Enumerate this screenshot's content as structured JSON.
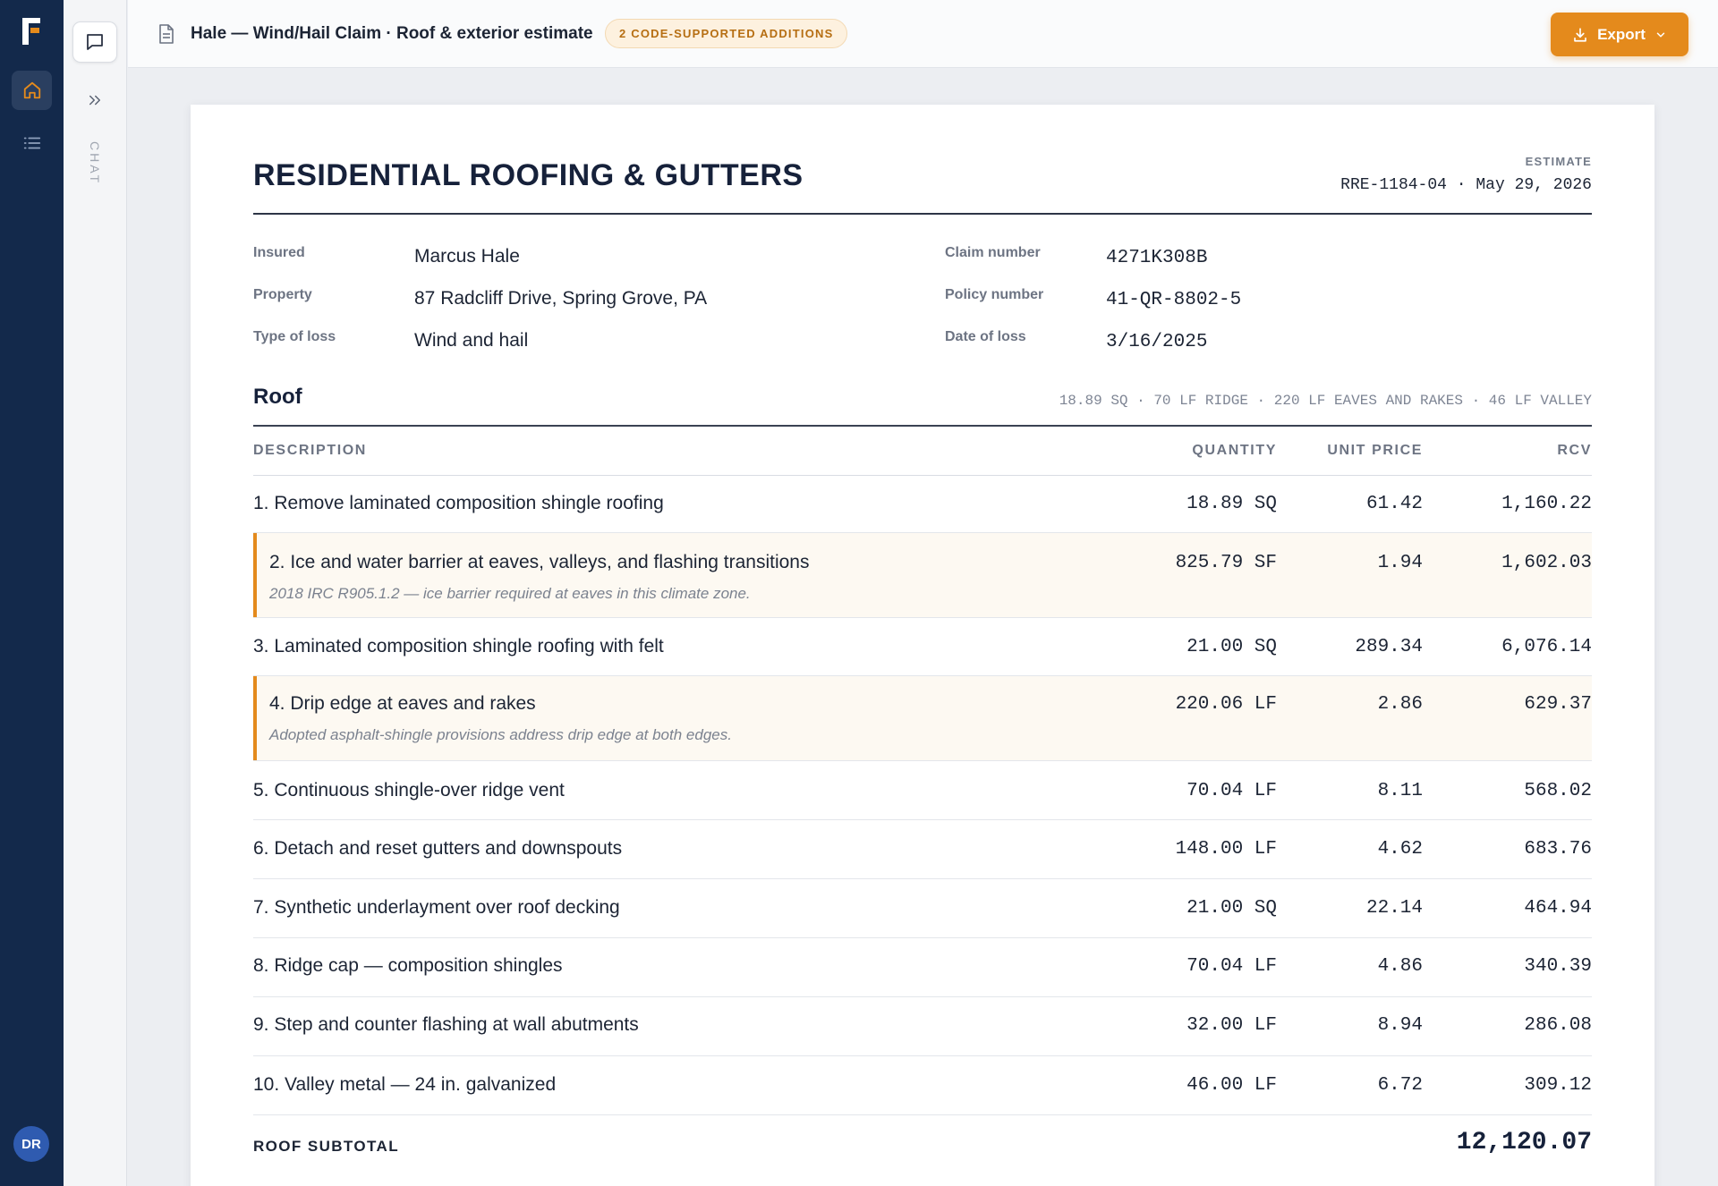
{
  "colors": {
    "rail": "#13294b",
    "accent": "#e48a1c",
    "badge_bg": "#fdf1df",
    "flag_bg": "#fdf9f2"
  },
  "rail": {
    "avatar_initials": "DR",
    "icons": [
      "home-icon",
      "list-icon"
    ]
  },
  "panel": {
    "chat_label": "CHAT",
    "icons": [
      "chat-bubble-icon",
      "double-chevron-right-icon"
    ]
  },
  "header": {
    "title": "Hale — Wind/Hail Claim · Roof & exterior estimate",
    "badge": "2 CODE-SUPPORTED ADDITIONS",
    "export_label": "Export"
  },
  "doc": {
    "title": "RESIDENTIAL ROOFING & GUTTERS",
    "estimate_label": "ESTIMATE",
    "estimate_meta": "RRE-1184-04 · May 29, 2026",
    "info_left": [
      {
        "label": "Insured",
        "value": "Marcus Hale"
      },
      {
        "label": "Property",
        "value": "87 Radcliff Drive, Spring Grove, PA"
      },
      {
        "label": "Type of loss",
        "value": "Wind and hail"
      }
    ],
    "info_right": [
      {
        "label": "Claim number",
        "value": "4271K308B"
      },
      {
        "label": "Policy number",
        "value": "41-QR-8802-5"
      },
      {
        "label": "Date of loss",
        "value": "3/16/2025"
      }
    ],
    "section": {
      "title": "Roof",
      "meta": "18.89 SQ · 70 LF RIDGE · 220 LF EAVES AND RAKES · 46 LF VALLEY"
    },
    "columns": {
      "description": "DESCRIPTION",
      "quantity": "QUANTITY",
      "unit_price": "UNIT PRICE",
      "rcv": "RCV"
    },
    "items": [
      {
        "desc": "1. Remove laminated composition shingle roofing",
        "qty": "18.89 SQ",
        "price": "61.42",
        "rcv": "1,160.22"
      },
      {
        "desc": "2. Ice and water barrier at eaves, valleys, and flashing transitions",
        "qty": "825.79 SF",
        "price": "1.94",
        "rcv": "1,602.03",
        "note": "2018 IRC R905.1.2 — ice barrier required at eaves in this climate zone."
      },
      {
        "desc": "3. Laminated composition shingle roofing with felt",
        "qty": "21.00 SQ",
        "price": "289.34",
        "rcv": "6,076.14"
      },
      {
        "desc": "4. Drip edge at eaves and rakes",
        "qty": "220.06 LF",
        "price": "2.86",
        "rcv": "629.37",
        "note": "Adopted asphalt-shingle provisions address drip edge at both edges."
      },
      {
        "desc": "5. Continuous shingle-over ridge vent",
        "qty": "70.04 LF",
        "price": "8.11",
        "rcv": "568.02"
      },
      {
        "desc": "6. Detach and reset gutters and downspouts",
        "qty": "148.00 LF",
        "price": "4.62",
        "rcv": "683.76"
      },
      {
        "desc": "7. Synthetic underlayment over roof decking",
        "qty": "21.00 SQ",
        "price": "22.14",
        "rcv": "464.94"
      },
      {
        "desc": "8. Ridge cap — composition shingles",
        "qty": "70.04 LF",
        "price": "4.86",
        "rcv": "340.39"
      },
      {
        "desc": "9. Step and counter flashing at wall abutments",
        "qty": "32.00 LF",
        "price": "8.94",
        "rcv": "286.08"
      },
      {
        "desc": "10. Valley metal — 24 in. galvanized",
        "qty": "46.00 LF",
        "price": "6.72",
        "rcv": "309.12"
      }
    ],
    "subtotal_label": "ROOF SUBTOTAL",
    "subtotal_value": "12,120.07"
  }
}
